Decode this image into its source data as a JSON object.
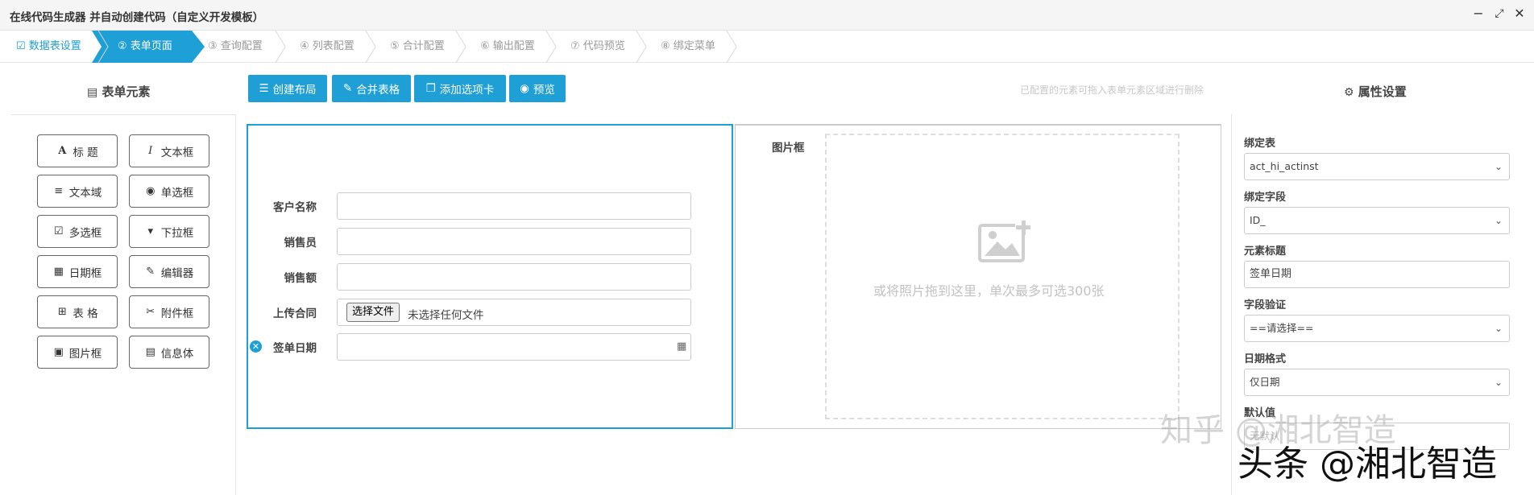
{
  "window": {
    "title": "在线代码生成器 并自动创建代码（自定义开发模板）"
  },
  "steps": [
    {
      "label": "数据表设置",
      "icon": "checkbox-icon",
      "state": "done"
    },
    {
      "label": "表单页面",
      "icon": "②",
      "state": "active"
    },
    {
      "label": "查询配置",
      "icon": "③",
      "state": "todo"
    },
    {
      "label": "列表配置",
      "icon": "④",
      "state": "todo"
    },
    {
      "label": "合计配置",
      "icon": "⑤",
      "state": "todo"
    },
    {
      "label": "输出配置",
      "icon": "⑥",
      "state": "todo"
    },
    {
      "label": "代码预览",
      "icon": "⑦",
      "state": "todo"
    },
    {
      "label": "绑定菜单",
      "icon": "⑧",
      "state": "todo"
    }
  ],
  "palette": {
    "title": "表单元素",
    "items": [
      {
        "label": "标 题",
        "icon": "A"
      },
      {
        "label": "文本框",
        "icon": "I"
      },
      {
        "label": "文本域",
        "icon": "≡"
      },
      {
        "label": "单选框",
        "icon": "◉"
      },
      {
        "label": "多选框",
        "icon": "☑"
      },
      {
        "label": "下拉框",
        "icon": "▾"
      },
      {
        "label": "日期框",
        "icon": "▦"
      },
      {
        "label": "编辑器",
        "icon": "✎"
      },
      {
        "label": "表 格",
        "icon": "⊞"
      },
      {
        "label": "附件框",
        "icon": "✂"
      },
      {
        "label": "图片框",
        "icon": "▣"
      },
      {
        "label": "信息体",
        "icon": "▤"
      }
    ]
  },
  "toolbar": {
    "create_layout": "创建布局",
    "merge_table": "合并表格",
    "add_tab": "添加选项卡",
    "preview": "预览",
    "hint": "已配置的元素可拖入表单元素区域进行删除"
  },
  "form": {
    "fields": [
      {
        "label": "客户名称",
        "value": ""
      },
      {
        "label": "销售员",
        "value": ""
      },
      {
        "label": "销售额",
        "value": ""
      },
      {
        "label": "上传合同",
        "file_button": "选择文件",
        "file_text": "未选择任何文件"
      },
      {
        "label": "签单日期",
        "value": ""
      }
    ]
  },
  "image_box": {
    "label": "图片框",
    "drop_text": "或将照片拖到这里，单次最多可选300张"
  },
  "props": {
    "title": "属性设置",
    "bind_table_label": "绑定表",
    "bind_table_value": "act_hi_actinst",
    "bind_field_label": "绑定字段",
    "bind_field_value": "ID_",
    "element_title_label": "元素标题",
    "element_title_value": "签单日期",
    "validation_label": "字段验证",
    "validation_value": "==请选择==",
    "date_format_label": "日期格式",
    "date_format_value": "仅日期",
    "default_label": "默认值",
    "default_value": "无默认"
  },
  "watermarks": [
    "知乎 @湘北智造",
    "头条 @湘北智造"
  ],
  "colors": {
    "accent": "#1e9fd6"
  }
}
